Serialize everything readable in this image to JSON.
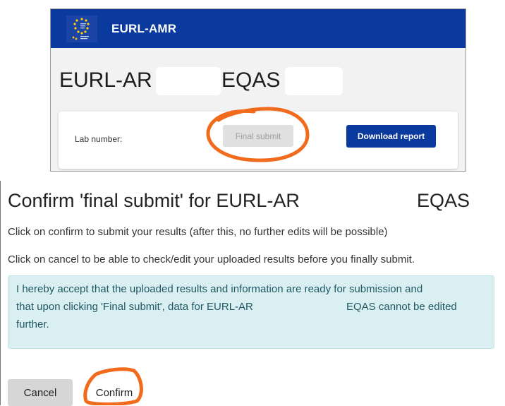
{
  "app": {
    "brand": "EURL-AMR",
    "logo_icon": "eu-flag-logo-icon",
    "colors": {
      "header": "#0b3a9e",
      "primary_button": "#0b3a9e",
      "disabled_button": "#e0e0e0"
    }
  },
  "page": {
    "title_part1": "EURL-AR",
    "title_part2": "EQAS"
  },
  "card": {
    "lab_number_label": "Lab number:",
    "final_submit_label": "Final submit",
    "download_report_label": "Download report"
  },
  "dialog": {
    "title_part1": "Confirm 'final submit' for EURL-AR",
    "title_part2": "EQAS",
    "line1": "Click on confirm to submit your results (after this, no further edits will be possible)",
    "line2": "Click on cancel to be able to check/edit your uploaded results before you finally submit.",
    "alert_line1": "I hereby accept that the uploaded results and information are ready for submission and",
    "alert_line2_a": "that upon clicking 'Final submit', data for EURL-AR",
    "alert_line2_b": "EQAS cannot be edited",
    "alert_line3": "further.",
    "alert_color": "#d9eff2",
    "cancel_label": "Cancel",
    "confirm_label": "Confirm"
  },
  "annotation": {
    "highlight_color": "#f26b1d"
  }
}
